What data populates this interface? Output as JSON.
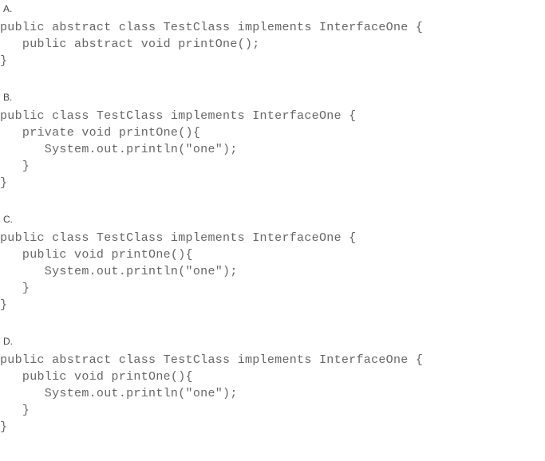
{
  "options": [
    {
      "label": "A.",
      "lines": [
        "public abstract class TestClass implements InterfaceOne {",
        "   public abstract void printOne();",
        "}"
      ]
    },
    {
      "label": "B.",
      "lines": [
        "public class TestClass implements InterfaceOne {",
        "   private void printOne(){",
        "      System.out.println(\"one\");",
        "   }",
        "}"
      ]
    },
    {
      "label": "C.",
      "lines": [
        "public class TestClass implements InterfaceOne {",
        "   public void printOne(){",
        "      System.out.println(\"one\");",
        "   }",
        "}"
      ]
    },
    {
      "label": "D.",
      "lines": [
        "public abstract class TestClass implements InterfaceOne {",
        "   public void printOne(){",
        "      System.out.println(\"one\");",
        "   }",
        "}"
      ]
    }
  ]
}
